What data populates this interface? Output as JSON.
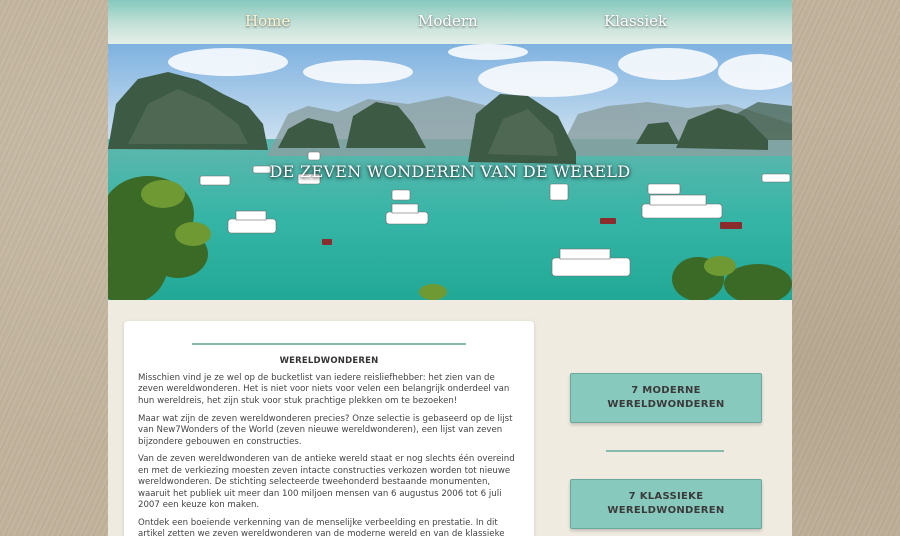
{
  "nav": {
    "items": [
      {
        "label": "Home",
        "active": true
      },
      {
        "label": "Modern",
        "active": false
      },
      {
        "label": "Klassiek",
        "active": false
      }
    ]
  },
  "hero": {
    "title": "DE ZEVEN WONDEREN VAN DE WERELD",
    "image": "ha-long-bay-islands-and-boats"
  },
  "article": {
    "heading": "WERELDWONDEREN",
    "paragraphs": [
      "Misschien vind je ze wel op de bucketlist van iedere reisliefhebber: het zien van de zeven wereldwonderen. Het is niet voor niets voor velen een belangrijk onderdeel van hun wereldreis, het zijn stuk voor stuk prachtige plekken om te bezoeken!",
      "Maar wat zijn de zeven wereldwonderen precies? Onze selectie is gebaseerd op de lijst van New7Wonders of the World (zeven nieuwe wereldwonderen), een lijst van zeven bijzondere gebouwen en constructies.",
      "Van de zeven wereldwonderen van de antieke wereld staat er nog slechts één overeind en met de verkiezing moesten zeven intacte constructies verkozen worden tot nieuwe wereldwonderen. De stichting selecteerde tweehonderd bestaande monumenten, waaruit het publiek uit meer dan 100 miljoen mensen van 6 augustus 2006 tot 6 juli 2007 een keuze kon maken.",
      "Ontdek een boeiende verkenning van de menselijke verbeelding en prestatie. In dit artikel zetten we zeven wereldwonderen van de moderne wereld en van de klassieke wereld voor je op een rij."
    ]
  },
  "sidebar": {
    "modern_button": "7 MODERNE WERELDWONDEREN",
    "classic_button": "7 KLASSIEKE WERELDWONDEREN"
  },
  "colors": {
    "accent": "#88c9be",
    "rule": "#87b9af",
    "nav_gradient_top": "#86c8bd",
    "page_bg": "#efebe1"
  }
}
